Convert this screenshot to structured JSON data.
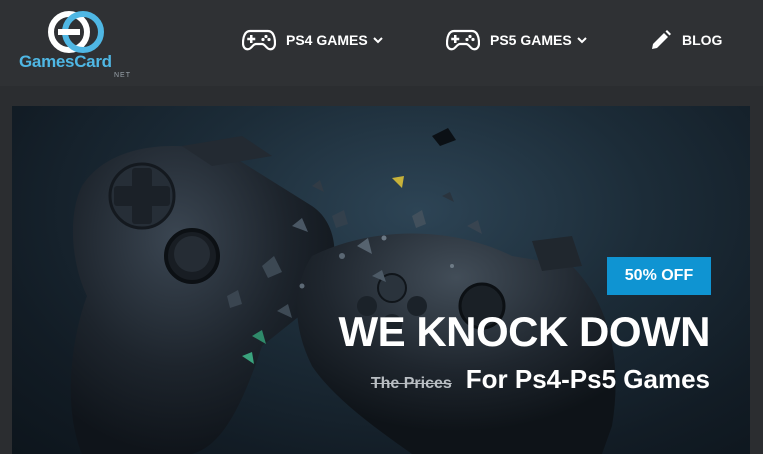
{
  "header": {
    "logo": {
      "brand": "GamesCard",
      "suffix": "NET"
    },
    "nav": [
      {
        "label": "PS4 GAMES",
        "icon": "gamepad-icon",
        "has_dropdown": true
      },
      {
        "label": "PS5 GAMES",
        "icon": "gamepad-icon",
        "has_dropdown": true
      },
      {
        "label": "BLOG",
        "icon": "pencil-icon",
        "has_dropdown": false
      }
    ]
  },
  "hero": {
    "badge": "50% OFF",
    "headline": "WE KNOCK DOWN",
    "strikethrough": "The Prices",
    "subline": "For Ps4-Ps5 Games"
  },
  "colors": {
    "accent": "#0f94d2",
    "logo_blue": "#4fb7e4",
    "header_bg": "#2f3134"
  }
}
